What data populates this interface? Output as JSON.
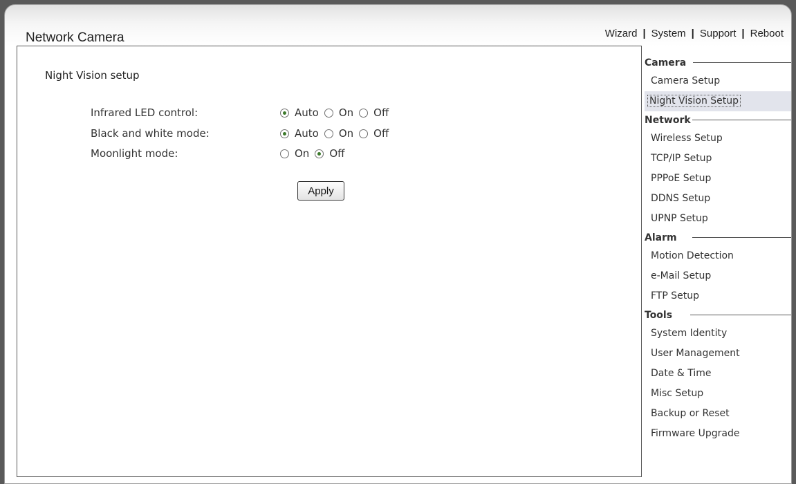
{
  "app": {
    "title": "Network Camera"
  },
  "topnav": {
    "items": [
      "Wizard",
      "System",
      "Support",
      "Reboot"
    ],
    "separator": "|"
  },
  "main": {
    "title": "Night Vision setup",
    "rows": [
      {
        "label": "Infrared LED control:",
        "options": [
          "Auto",
          "On",
          "Off"
        ],
        "selected": "Auto"
      },
      {
        "label": "Black and white mode:",
        "options": [
          "Auto",
          "On",
          "Off"
        ],
        "selected": "Auto"
      },
      {
        "label": "Moonlight mode:",
        "options": [
          "On",
          "Off"
        ],
        "selected": "Off"
      }
    ],
    "apply_label": "Apply"
  },
  "sidebar": {
    "active": "Night Vision Setup",
    "sections": [
      {
        "title": "Camera",
        "items": [
          "Camera Setup",
          "Night Vision Setup"
        ]
      },
      {
        "title": "Network",
        "items": [
          "Wireless Setup",
          "TCP/IP Setup",
          "PPPoE Setup",
          "DDNS Setup",
          "UPNP Setup"
        ]
      },
      {
        "title": "Alarm",
        "items": [
          "Motion Detection",
          "e-Mail Setup",
          "FTP Setup"
        ]
      },
      {
        "title": "Tools",
        "items": [
          "System Identity",
          "User Management",
          "Date & Time",
          "Misc Setup",
          "Backup or Reset",
          "Firmware Upgrade"
        ]
      }
    ]
  },
  "colors": {
    "radio_dot": "#3d7a2c",
    "active_item_bg": "#e2e4ec",
    "page_bg": "#ffffff"
  }
}
